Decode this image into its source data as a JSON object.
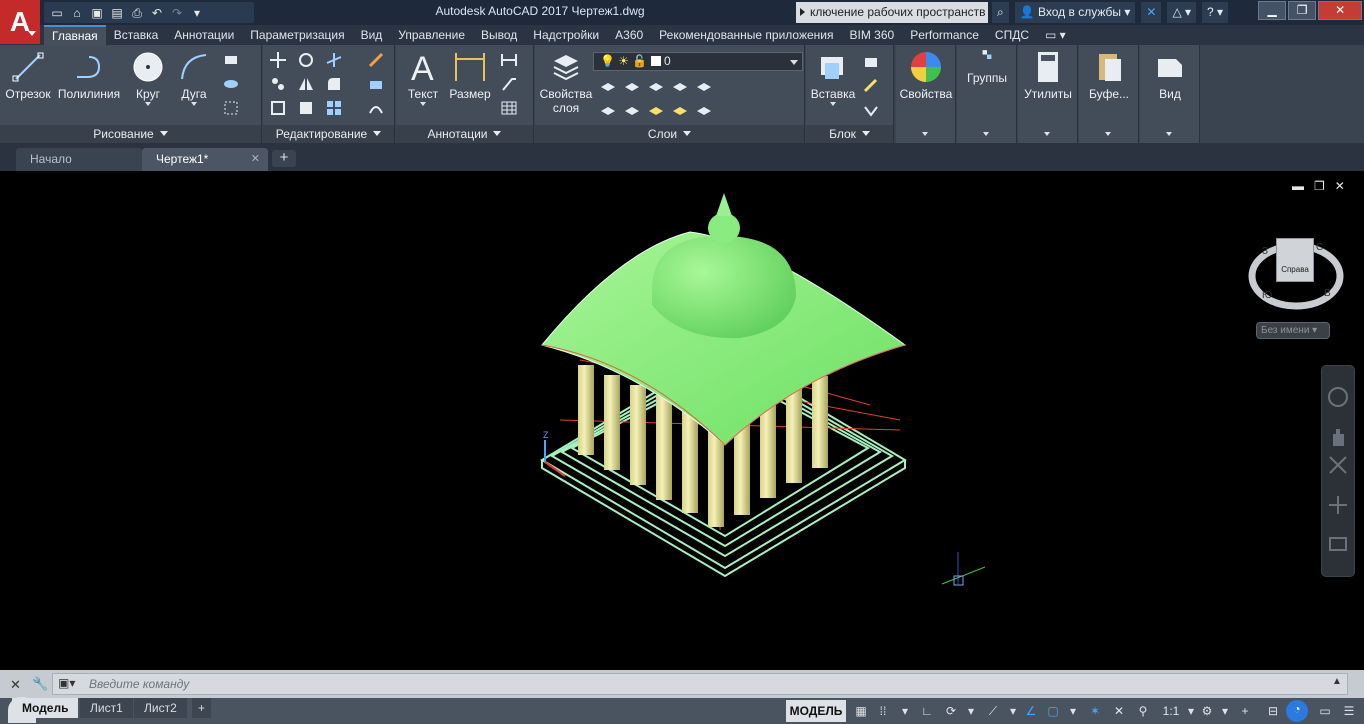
{
  "app": {
    "logo_letter": "A",
    "title": "Autodesk AutoCAD 2017    Чертеж1.dwg",
    "workspace_switch": "ключение рабочих пространств",
    "sign_in": "Вход в службы"
  },
  "ribbon_tabs": [
    {
      "label": "Главная",
      "active": true
    },
    {
      "label": "Вставка"
    },
    {
      "label": "Аннотации"
    },
    {
      "label": "Параметризация"
    },
    {
      "label": "Вид"
    },
    {
      "label": "Управление"
    },
    {
      "label": "Вывод"
    },
    {
      "label": "Надстройки"
    },
    {
      "label": "A360"
    },
    {
      "label": "Рекомендованные приложения"
    },
    {
      "label": "BIM 360"
    },
    {
      "label": "Performance"
    },
    {
      "label": "СПДС"
    }
  ],
  "panels": {
    "draw": {
      "title": "Рисование",
      "line": "Отрезок",
      "polyline": "Полилиния",
      "circle": "Круг",
      "arc": "Дуга"
    },
    "modify": {
      "title": "Редактирование"
    },
    "annotation": {
      "title": "Аннотации",
      "text": "Текст",
      "dimension": "Размер"
    },
    "layers": {
      "title": "Слои",
      "layer_props_line1": "Свойства",
      "layer_props_line2": "слоя",
      "current_layer": "0"
    },
    "block": {
      "title": "Блок",
      "insert": "Вставка"
    },
    "properties": {
      "label": "Свойства"
    },
    "groups": {
      "label": "Группы"
    },
    "utilities": {
      "label": "Утилиты"
    },
    "clipboard": {
      "label": "Буфе..."
    },
    "view": {
      "label": "Вид"
    }
  },
  "doc_tabs": [
    {
      "label": "Начало"
    },
    {
      "label": "Чертеж1*",
      "active": true
    }
  ],
  "viewcube": {
    "face": "Справа",
    "north": "С",
    "south": "Ю",
    "east": "В",
    "west": "З",
    "wcs": "Без имени"
  },
  "command_line": {
    "placeholder": "Введите команду"
  },
  "layout_tabs": [
    {
      "label": "Модель",
      "active": true
    },
    {
      "label": "Лист1"
    },
    {
      "label": "Лист2"
    }
  ],
  "status": {
    "model": "МОДЕЛЬ",
    "scale": "1:1"
  },
  "colors": {
    "accent": "#4a8ed6",
    "logo": "#c42a2a",
    "model_green": "#8ef080"
  }
}
